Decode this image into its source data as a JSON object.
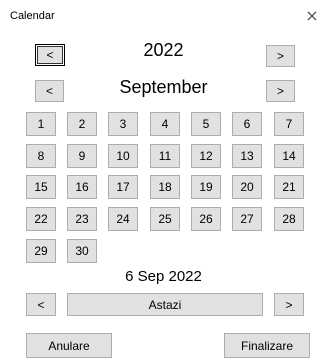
{
  "window": {
    "title": "Calendar",
    "close_icon": "×"
  },
  "year": {
    "prev_label": "<",
    "value": "2022",
    "next_label": ">"
  },
  "month": {
    "prev_label": "<",
    "value": "September",
    "next_label": ">"
  },
  "days": [
    "1",
    "2",
    "3",
    "4",
    "5",
    "6",
    "7",
    "8",
    "9",
    "10",
    "11",
    "12",
    "13",
    "14",
    "15",
    "16",
    "17",
    "18",
    "19",
    "20",
    "21",
    "22",
    "23",
    "24",
    "25",
    "26",
    "27",
    "28",
    "29",
    "30"
  ],
  "selected_date": "6 Sep 2022",
  "today_nav": {
    "prev_label": "<",
    "today_label": "Astazi",
    "next_label": ">"
  },
  "footer": {
    "cancel_label": "Anulare",
    "finish_label": "Finalizare"
  }
}
